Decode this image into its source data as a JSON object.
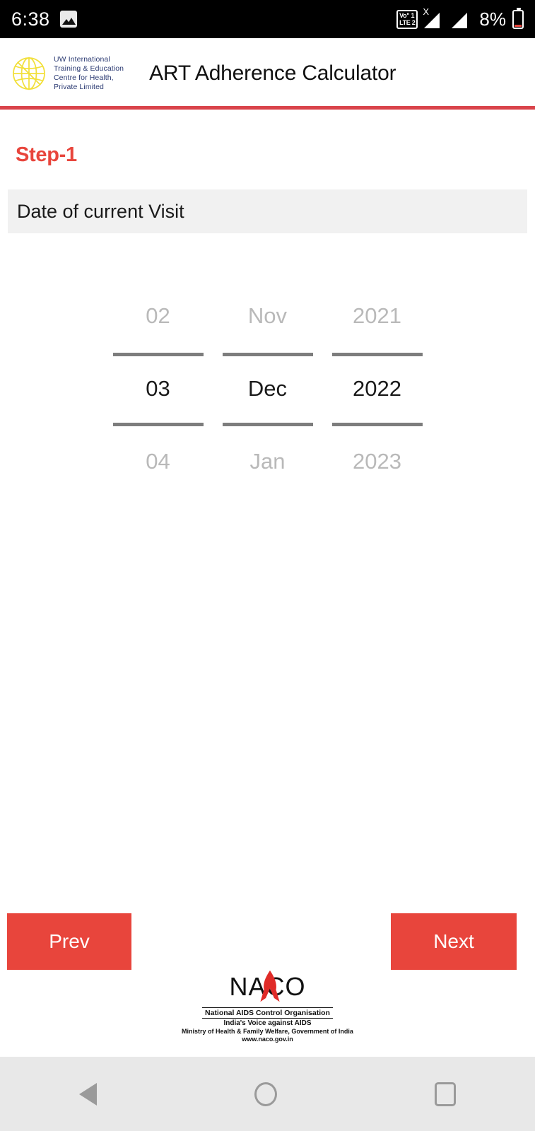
{
  "status_bar": {
    "clock": "6:38",
    "notification_icon": "gallery-icon",
    "volte_line1": "Vo\" 1",
    "volte_line2": "LTE 2",
    "sim1_label": "X",
    "battery_percent": "8%"
  },
  "header": {
    "org_logo_line1": "UW International",
    "org_logo_line2": "Training & Education",
    "org_logo_line3": "Centre for Health,",
    "org_logo_line4": "Private Limited",
    "title": "ART Adherence Calculator",
    "accent_color": "#e8453c"
  },
  "content": {
    "step_label": "Step-1",
    "field_label": "Date of current Visit"
  },
  "date_picker": {
    "day": {
      "prev": "02",
      "selected": "03",
      "next": "04"
    },
    "month": {
      "prev": "Nov",
      "selected": "Dec",
      "next": "Jan"
    },
    "year": {
      "prev": "2021",
      "selected": "2022",
      "next": "2023"
    }
  },
  "actions": {
    "prev_label": "Prev",
    "next_label": "Next",
    "button_color": "#e8453c"
  },
  "footer": {
    "brand": "NACO",
    "line1": "National AIDS Control Organisation",
    "line2": "India's Voice against AIDS",
    "line3": "Ministry of Health & Family Welfare, Government of India",
    "line4": "www.naco.gov.in"
  },
  "nav_bar": {
    "back": "back-icon",
    "home": "home-icon",
    "recents": "recents-icon"
  }
}
